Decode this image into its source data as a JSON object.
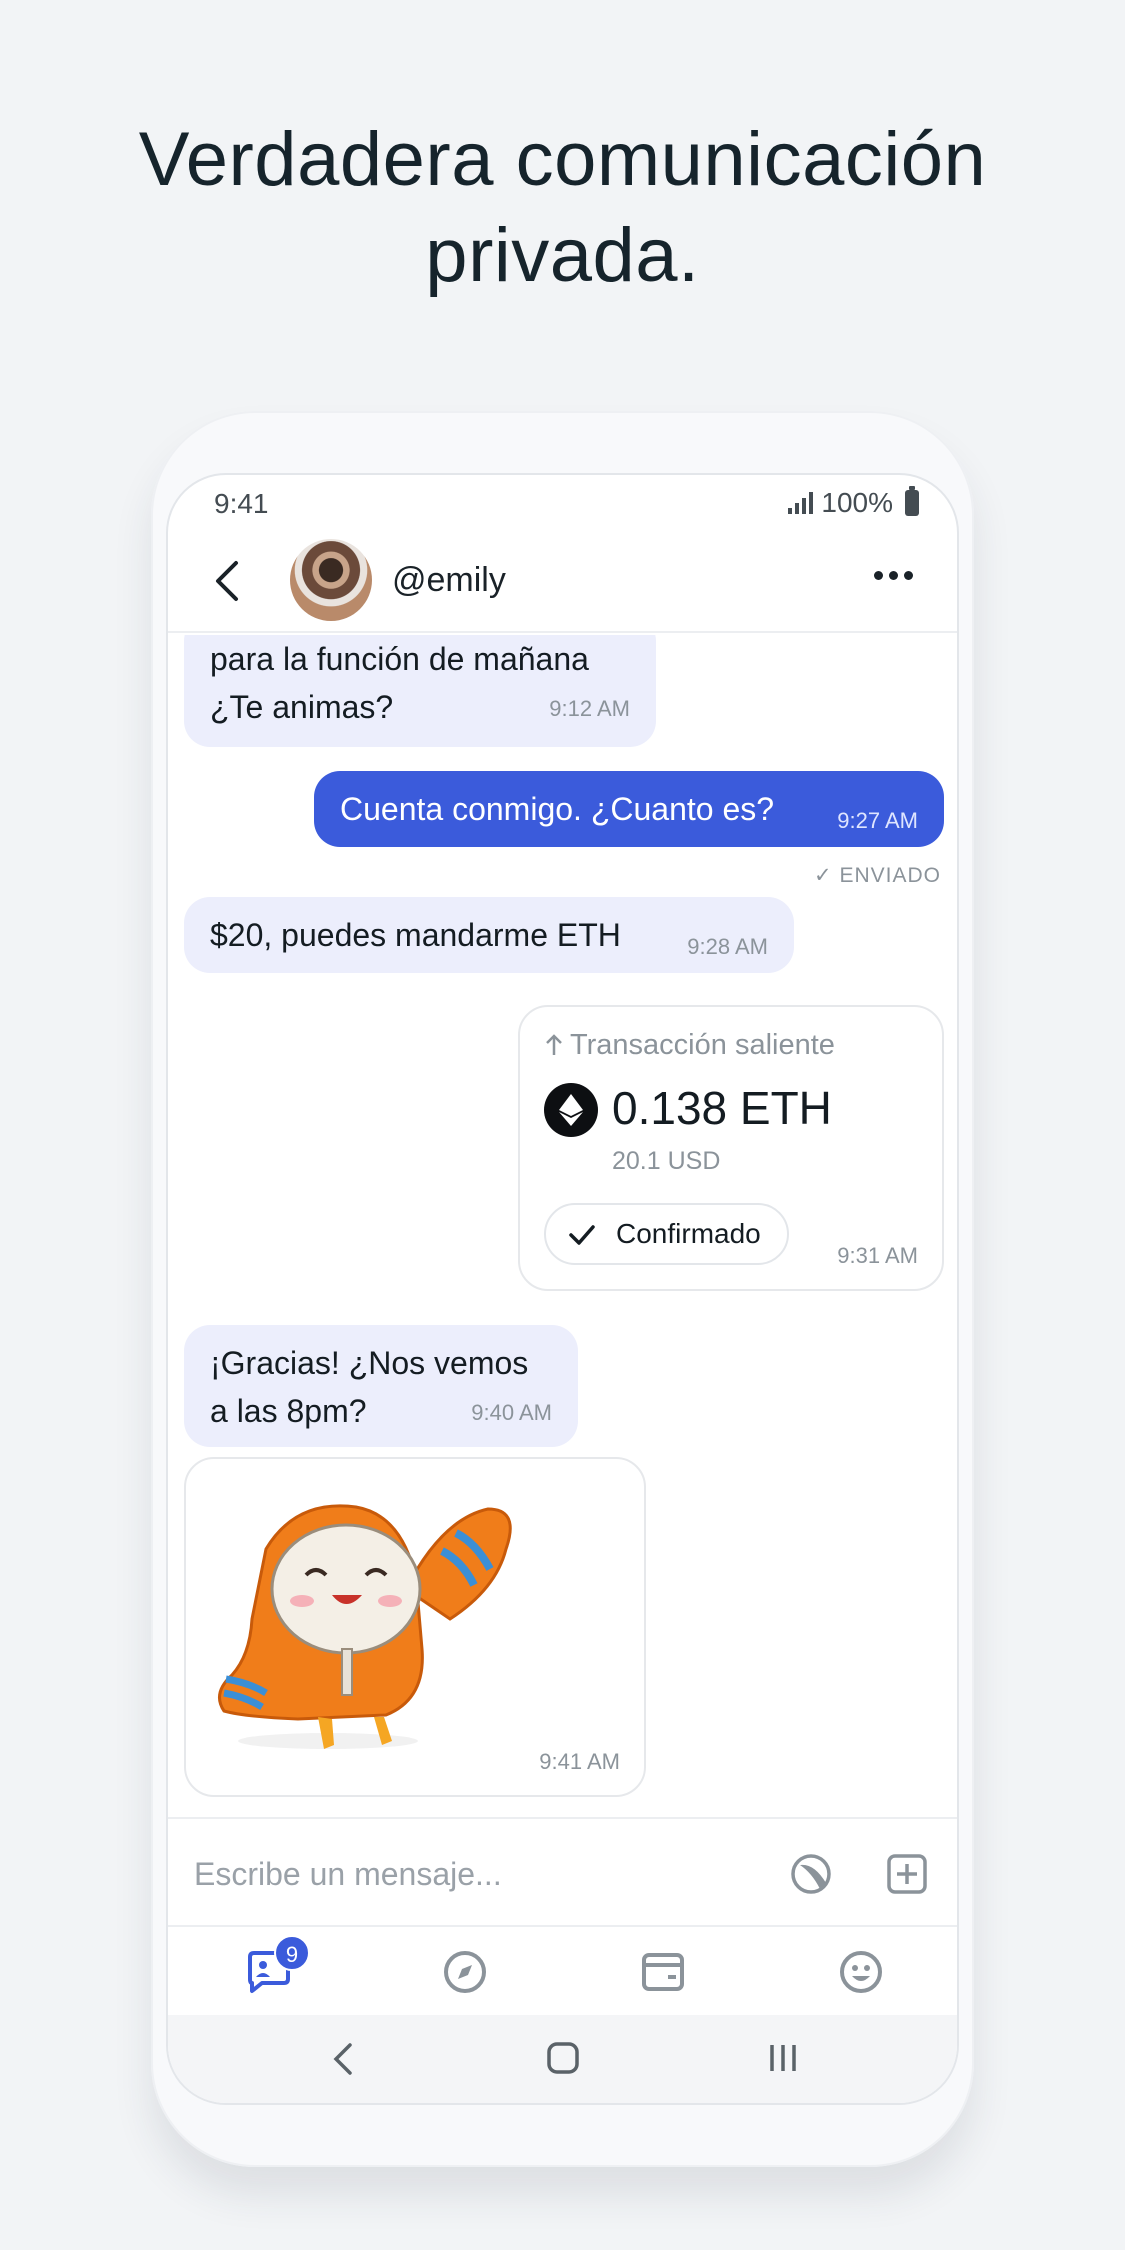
{
  "headline": {
    "line1": "Verdadera comunicación",
    "line2": "privada."
  },
  "status": {
    "time": "9:41",
    "battery": "100%"
  },
  "chat_header": {
    "handle": "@emily"
  },
  "messages": [
    {
      "text_line1": "para la función de mañana",
      "text_line2": "¿Te animas?",
      "time": "9:12 AM"
    },
    {
      "text": "Cuenta conmigo. ¿Cuanto es?",
      "time": "9:27 AM",
      "status": "✓ ENVIADO"
    },
    {
      "text": "$20, puedes mandarme ETH",
      "time": "9:28 AM"
    },
    {
      "text_line1": "¡Gracias! ¿Nos vemos",
      "text_line2": "a las 8pm?",
      "time": "9:40 AM"
    }
  ],
  "transaction": {
    "direction": "Transacción saliente",
    "amount": "0.138 ETH",
    "fiat": "20.1 USD",
    "status_label": "Confirmado",
    "time": "9:31 AM"
  },
  "sticker": {
    "time": "9:41 AM"
  },
  "composer": {
    "placeholder": "Escribe un mensaje..."
  },
  "tabs": {
    "chats_badge": "9"
  },
  "colors": {
    "accent": "#3b5bdb",
    "incoming_bubble": "#eceefc",
    "sticker_orange": "#f07d1a"
  },
  "icons": [
    "back-icon",
    "more-icon",
    "ethereum-icon",
    "check-icon",
    "sticker-icon",
    "plus-icon",
    "chat-icon",
    "compass-icon",
    "wallet-icon",
    "emoji-icon"
  ]
}
